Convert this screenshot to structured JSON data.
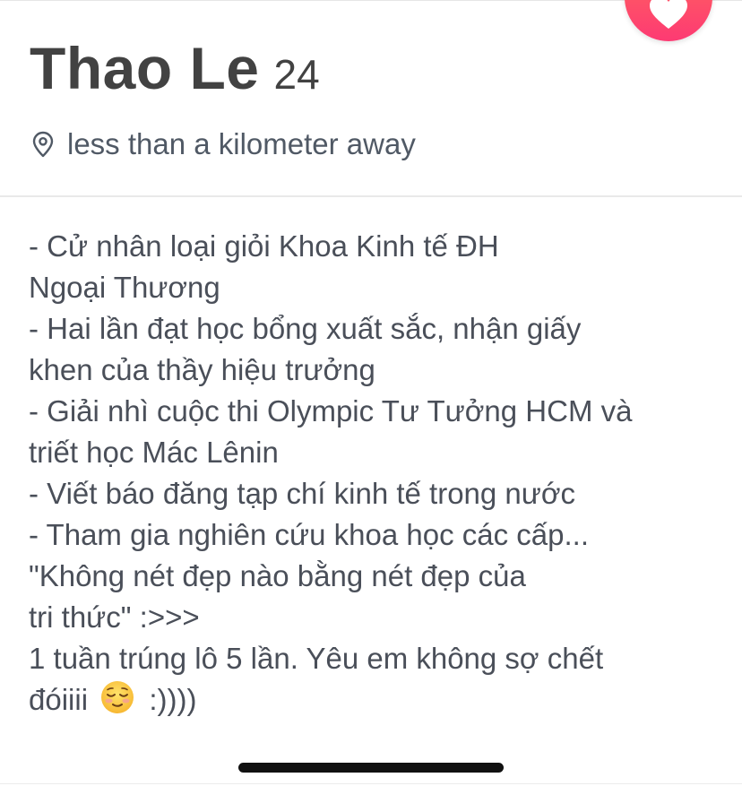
{
  "profile": {
    "name": "Thao Le",
    "age": "24",
    "distance": "less than a kilometer away",
    "icons": {
      "location": "map-pin-icon",
      "like": "heart-icon",
      "emoji": "relieved-face-emoji"
    },
    "colors": {
      "like_gradient_top": "#ff6a5b",
      "like_gradient_bottom": "#fd3a73",
      "text": "#424242"
    }
  },
  "bio": {
    "lines": [
      "- Cử nhân loại giỏi Khoa Kinh tế ĐH",
      "Ngoại Thương",
      "- Hai lần đạt học bổng xuất sắc, nhận giấy",
      "khen của thầy hiệu trưởng",
      "- Giải nhì cuộc thi Olympic Tư Tưởng HCM và",
      "triết học Mác Lênin",
      "- Viết báo đăng tạp chí kinh tế trong nước",
      "- Tham gia nghiên cứu khoa học các cấp...",
      "\"Không nét đẹp nào bằng nét đẹp của",
      "tri thức\" :>>>",
      "1 tuần trúng lô 5 lần. Yêu em không sợ chết"
    ],
    "last_line_before_emoji": "đóiiii",
    "last_line_after_emoji": ":))))"
  }
}
